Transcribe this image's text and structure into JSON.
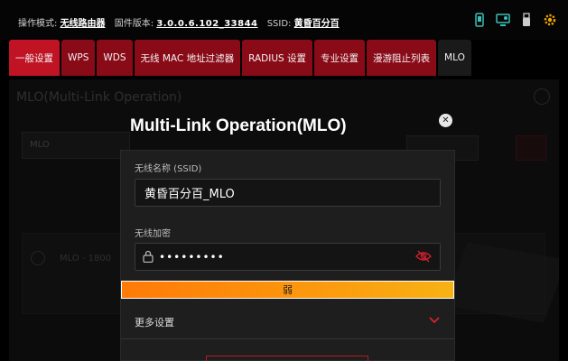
{
  "status_bar": {
    "mode_label": "操作模式:",
    "mode_value": "无线路由器",
    "firmware_label": "固件版本:",
    "firmware_value": "3.0.0.6.102_33844",
    "ssid_label": "SSID:",
    "ssid_value": "黄昏百分百"
  },
  "top_icons": [
    "app-icon",
    "network-icon",
    "usb-icon",
    "settings-gear-icon"
  ],
  "tabs": [
    {
      "label": "一般设置",
      "active": true
    },
    {
      "label": "WPS"
    },
    {
      "label": "WDS"
    },
    {
      "label": "无线 MAC 地址过滤器"
    },
    {
      "label": "RADIUS 设置"
    },
    {
      "label": "专业设置"
    },
    {
      "label": "漫游阻止列表"
    },
    {
      "label": "MLO"
    }
  ],
  "background_page": {
    "title": "MLO(Multi-Link Operation)",
    "field_value": "MLO",
    "row_text": "MLO - 1800"
  },
  "modal": {
    "title": "Multi-Link Operation(MLO)",
    "close_glyph": "✕",
    "ssid_label": "无线名称 (SSID)",
    "ssid_value": "黄昏百分百_MLO",
    "password_label": "无线加密",
    "password_value": "•••••••••",
    "strength_text": "弱",
    "more_settings_label": "更多设置"
  },
  "colors": {
    "accent": "#c01425",
    "tab": "#8a0b18",
    "strength_start": "#ff7a08",
    "strength_end": "#f7b214"
  }
}
